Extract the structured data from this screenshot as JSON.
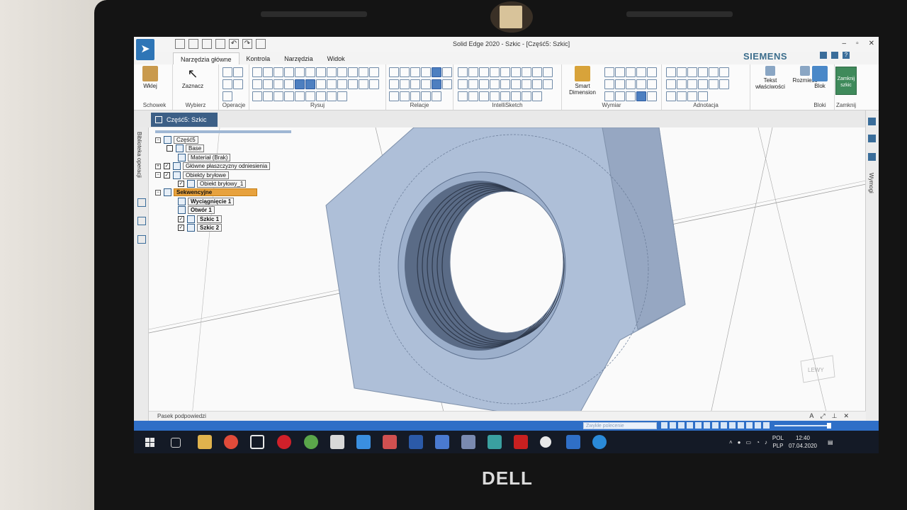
{
  "window": {
    "title": "Solid Edge 2020 - Szkic - [Część5: Szkic]",
    "brand": "SIEMENS"
  },
  "ribbon": {
    "tabs": [
      "Narzędzia główne",
      "Kontrola",
      "Narzędzia",
      "Widok"
    ],
    "active_tab": "Narzędzia główne",
    "groups": {
      "clipboard": {
        "button": "Wklej",
        "label": "Schowek"
      },
      "select": {
        "button": "Zaznacz",
        "label": "Wybierz"
      },
      "operations": {
        "label": "Operacje"
      },
      "draw": {
        "label": "Rysuj"
      },
      "relations": {
        "label": "Relacje"
      },
      "intellisketch": {
        "label": "IntelliSketch"
      },
      "dimension": {
        "button_line1": "Smart",
        "button_line2": "Dimension",
        "label": "Wymiar"
      },
      "annotation": {
        "label": "Adnotacja"
      },
      "properties": {
        "button_line1": "Tekst",
        "button_line2": "właściwości"
      },
      "distribute": {
        "button": "Rozmieść"
      },
      "blocks": {
        "button": "Blok",
        "label": "Bloki"
      },
      "close": {
        "button_line1": "Zamknij",
        "button_line2": "szkic",
        "label": "Zamknij"
      }
    }
  },
  "document_tab": {
    "label": "Część5: Szkic"
  },
  "left_panel": {
    "label": "Biblioteka operacji"
  },
  "right_panel": {
    "label": "Wymogi"
  },
  "pathfinder": {
    "items": [
      {
        "label": "Część5",
        "level": 0,
        "checked": null,
        "expander": "minus"
      },
      {
        "label": "Base",
        "level": 1,
        "checked": false,
        "expander": null
      },
      {
        "label": "Materiał (Brak)",
        "level": 2,
        "checked": null,
        "expander": null
      },
      {
        "label": "Główne płaszczyzny odniesienia",
        "level": 1,
        "checked": true,
        "expander": "plus"
      },
      {
        "label": "Obiekty bryłowe",
        "level": 1,
        "checked": true,
        "expander": "minus"
      },
      {
        "label": "Obiekt bryłowy_1",
        "level": 2,
        "checked": true,
        "expander": null
      },
      {
        "label": "Sekwencyjne",
        "level": 0,
        "checked": null,
        "expander": "minus",
        "highlighted": true
      },
      {
        "label": "Wyciągnięcie 1",
        "level": 2,
        "checked": null,
        "expander": null,
        "bold": true
      },
      {
        "label": "Otwór 1",
        "level": 2,
        "checked": null,
        "expander": null,
        "bold": true
      },
      {
        "label": "Szkic 1",
        "level": 2,
        "checked": true,
        "expander": null,
        "bold": true
      },
      {
        "label": "Szkic 2",
        "level": 2,
        "checked": true,
        "expander": null,
        "bold": true
      }
    ]
  },
  "viewport": {
    "view_cube_label": "LEWY"
  },
  "status": {
    "prompt": "Pasek podpowiedzi",
    "search_placeholder": "Zwykłe polecenie"
  },
  "taskbar": {
    "language_line1": "POL",
    "language_line2": "PLP",
    "time": "12:40",
    "date": "07.04.2020"
  },
  "laptop": {
    "brand": "DELL"
  },
  "colors": {
    "accent": "#2f6fc7",
    "highlight": "#e7a23e",
    "model_fill": "#aebfd8"
  }
}
